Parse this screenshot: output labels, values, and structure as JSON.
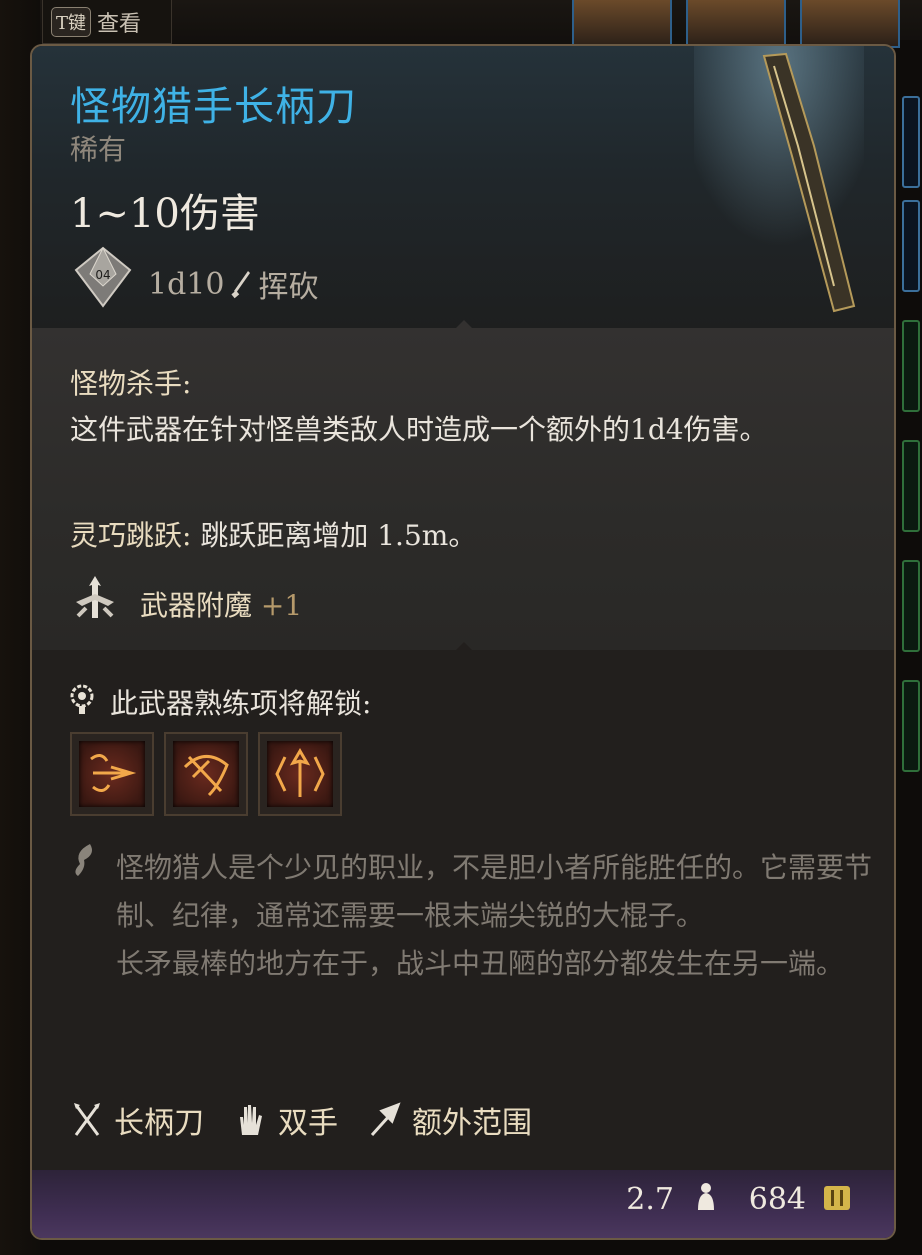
{
  "hotkey": {
    "key": "T键",
    "label": "查看"
  },
  "item": {
    "name": "怪物猎手长柄刀",
    "rarity": "稀有",
    "damage_range": "1~10伤害",
    "damage_dice": "1d10",
    "damage_type": "挥砍",
    "die_face": "04"
  },
  "passive": {
    "name": "怪物杀手:",
    "description": "这件武器在针对怪兽类敌人时造成一个额外的1d4伤害。",
    "agile_label": "灵巧跳跃:",
    "agile_text": "跳跃距离增加 1.5m。"
  },
  "enchant": {
    "label": "武器附魔",
    "value": "+1"
  },
  "proficiency": {
    "label": "此武器熟练项将解锁:",
    "actions": [
      {
        "icon": "weapon-action-1-icon"
      },
      {
        "icon": "weapon-action-2-icon"
      },
      {
        "icon": "weapon-action-3-icon"
      }
    ]
  },
  "flavor": {
    "p1": "怪物猎人是个少见的职业，不是胆小者所能胜任的。它需要节制、纪律，通常还需要一根末端尖锐的大棍子。",
    "p2": "长矛最棒的地方在于，战斗中丑陋的部分都发生在另一端。"
  },
  "properties": [
    {
      "label": "长柄刀",
      "icon": "polearm-icon"
    },
    {
      "label": "双手",
      "icon": "two-handed-icon"
    },
    {
      "label": "额外范围",
      "icon": "reach-icon"
    }
  ],
  "footer": {
    "weight": "2.7",
    "value": "684"
  },
  "colors": {
    "title": "#3fb2e6",
    "rarity": "#8f877c",
    "flavor": "#807a72",
    "footer": "#3f2e52"
  }
}
